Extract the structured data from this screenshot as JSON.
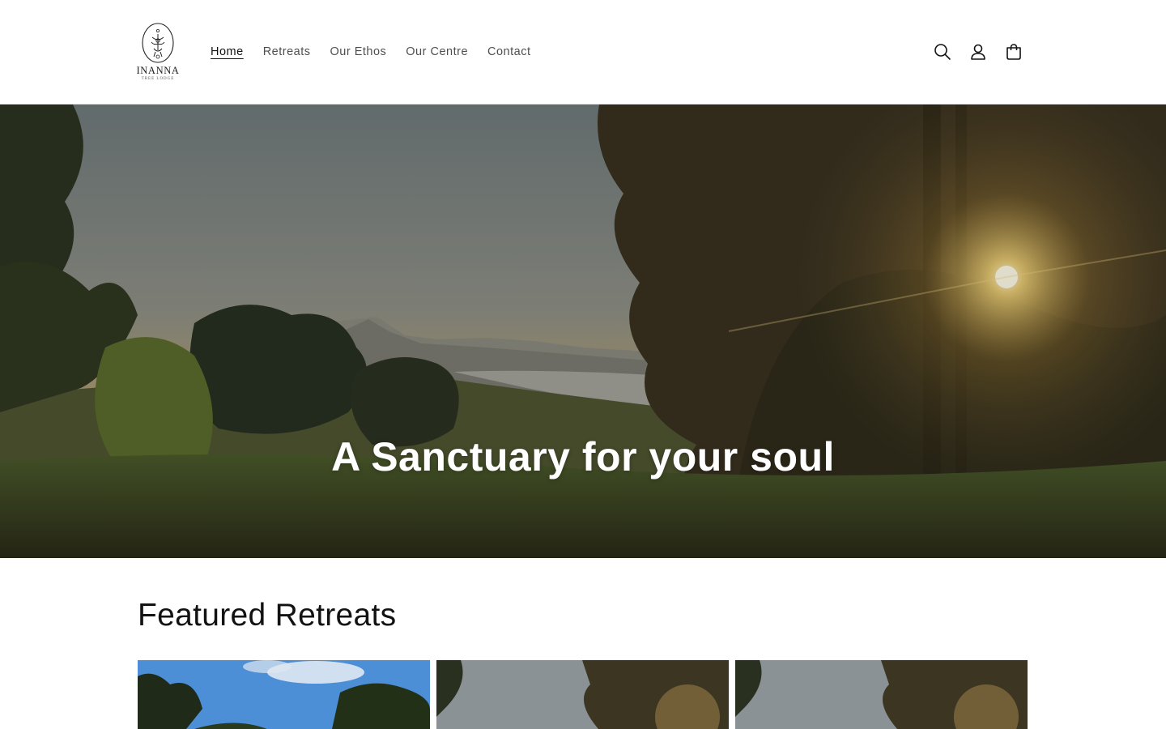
{
  "brand": {
    "name": "INANNA",
    "subtitle": "TREE LODGE"
  },
  "nav": {
    "items": [
      {
        "label": "Home",
        "active": true
      },
      {
        "label": "Retreats",
        "active": false
      },
      {
        "label": "Our Ethos",
        "active": false
      },
      {
        "label": "Our Centre",
        "active": false
      },
      {
        "label": "Contact",
        "active": false
      }
    ]
  },
  "header_icons": [
    "search-icon",
    "account-icon",
    "cart-icon"
  ],
  "hero": {
    "title": "A Sanctuary for your soul"
  },
  "featured": {
    "heading": "Featured Retreats",
    "cards": [
      {
        "image": "blue-sky-pine-trees"
      },
      {
        "image": "sunset-pine-trees"
      },
      {
        "image": "sunset-pine-trees"
      }
    ]
  },
  "colors": {
    "text": "#121212",
    "background": "#ffffff",
    "hero_overlay": "#000000"
  }
}
